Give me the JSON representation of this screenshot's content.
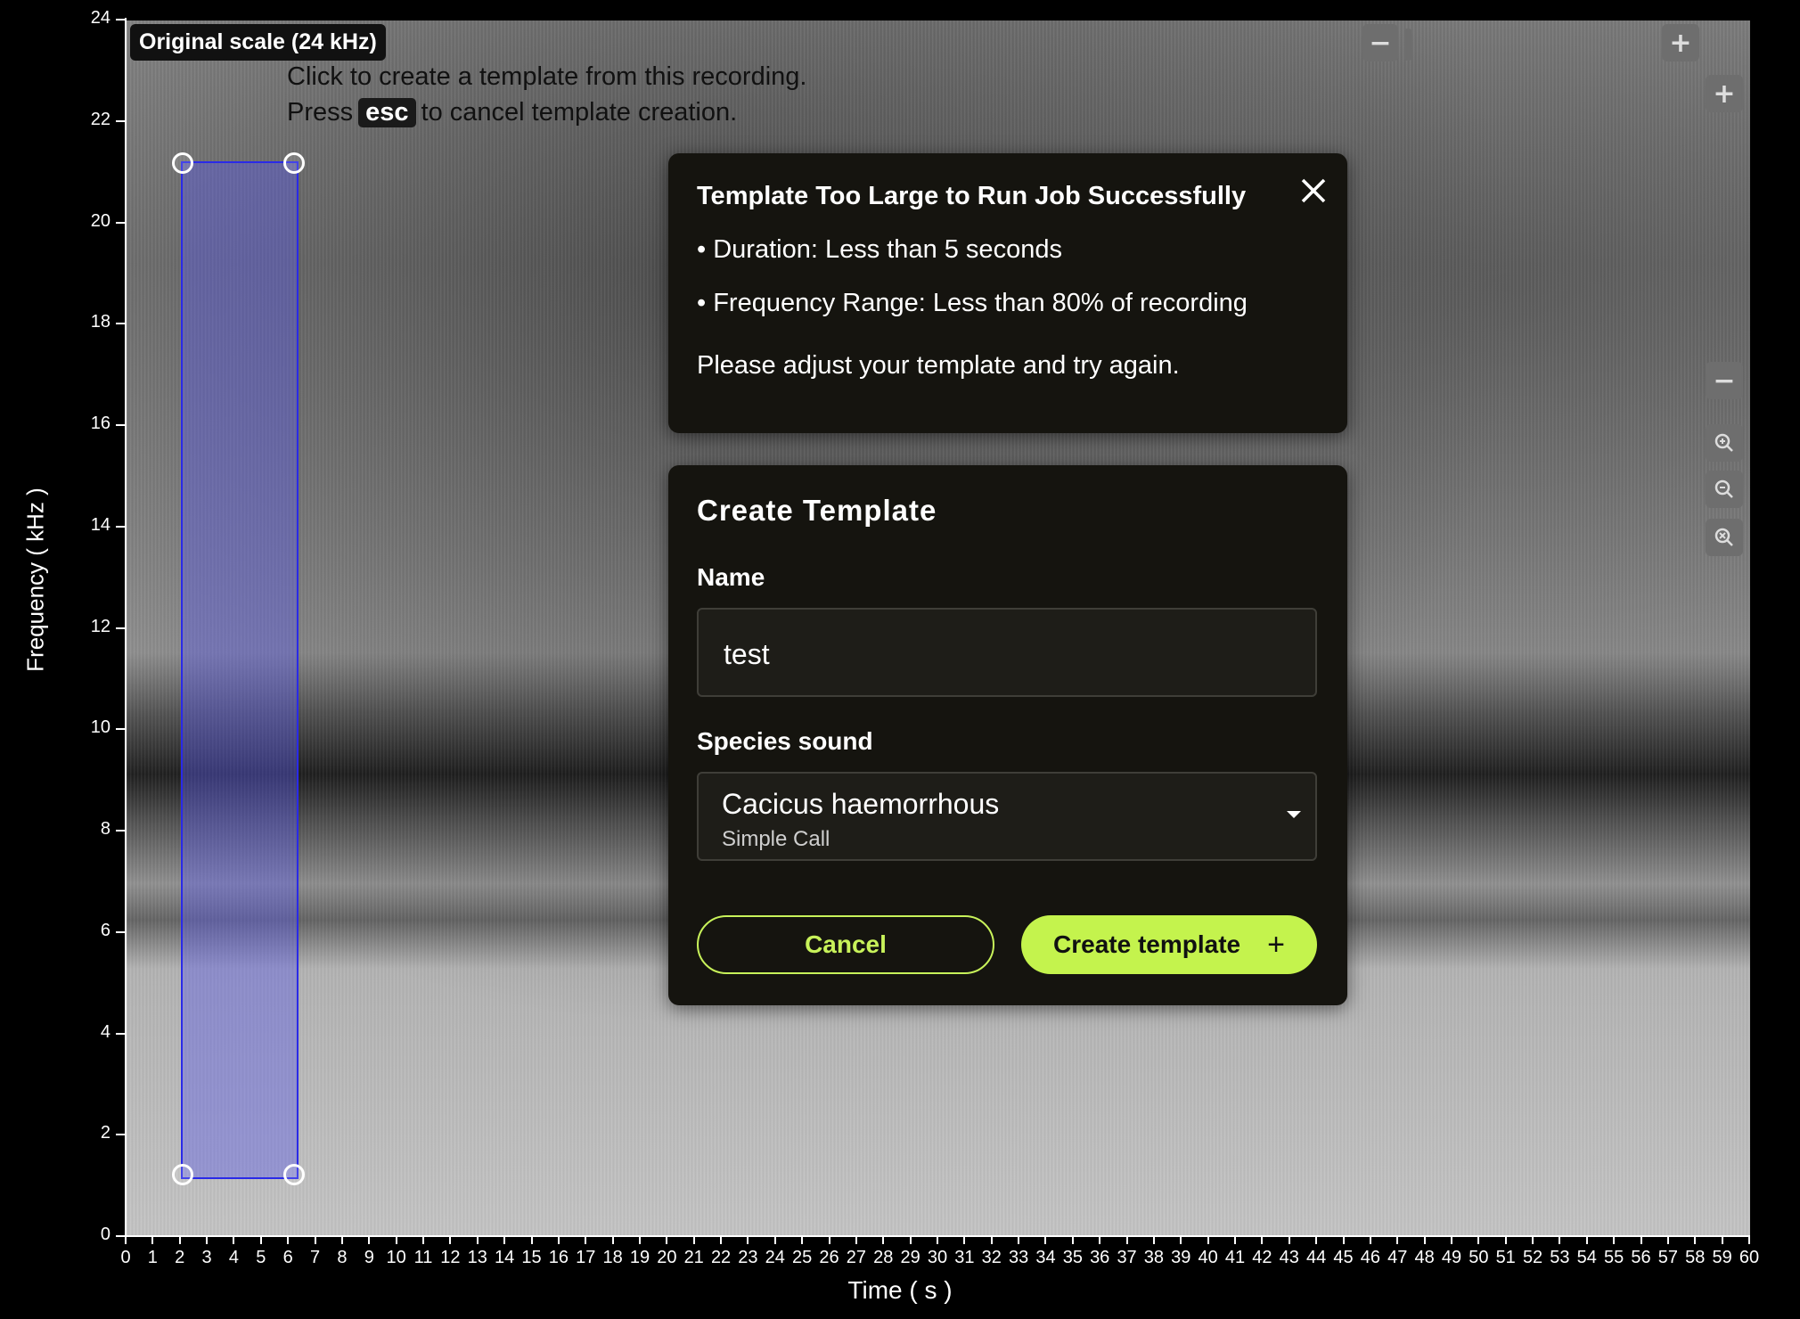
{
  "badge": {
    "scale": "Original scale (24 kHz)"
  },
  "hints": {
    "line1": "Click to create a template from this recording.",
    "line2_prefix": "Press",
    "line2_key": "esc",
    "line2_suffix": "to cancel template creation."
  },
  "axes": {
    "y_label": "Frequency ( kHz )",
    "x_label": "Time ( s )",
    "y_ticks": [
      "0",
      "2",
      "4",
      "6",
      "8",
      "10",
      "12",
      "14",
      "16",
      "18",
      "20",
      "22",
      "24"
    ],
    "x_ticks": [
      "0",
      "1",
      "2",
      "3",
      "4",
      "5",
      "6",
      "7",
      "8",
      "9",
      "10",
      "11",
      "12",
      "13",
      "14",
      "15",
      "16",
      "17",
      "18",
      "19",
      "20",
      "21",
      "22",
      "23",
      "24",
      "25",
      "26",
      "27",
      "28",
      "29",
      "30",
      "31",
      "32",
      "33",
      "34",
      "35",
      "36",
      "37",
      "38",
      "39",
      "40",
      "41",
      "42",
      "43",
      "44",
      "45",
      "46",
      "47",
      "48",
      "49",
      "50",
      "51",
      "52",
      "53",
      "54",
      "55",
      "56",
      "57",
      "58",
      "59",
      "60"
    ]
  },
  "selection": {
    "time_start_s": 2.1,
    "time_end_s": 6.2,
    "freq_low_khz": 1.2,
    "freq_high_khz": 21.2
  },
  "error_dialog": {
    "title": "Template Too Large to Run Job Successfully",
    "line1": "• Duration: Less than 5 seconds",
    "line2": "• Frequency Range: Less than 80% of recording",
    "line3": "Please adjust your template and try again."
  },
  "create_dialog": {
    "title": "Create Template",
    "name_label": "Name",
    "name_value": "test",
    "species_label": "Species sound",
    "species_name": "Cacicus haemorrhous",
    "species_sound": "Simple Call",
    "cancel_label": "Cancel",
    "create_label": "Create template"
  },
  "controls": {
    "icons": [
      "minus-icon",
      "plus-icon",
      "plus-icon",
      "minus-icon",
      "zoom-in-icon",
      "zoom-out-icon",
      "zoom-reset-icon"
    ],
    "colors": {
      "accent": "#c4f34d",
      "selection": "#2a2ae8",
      "panel": "#15140f"
    }
  }
}
